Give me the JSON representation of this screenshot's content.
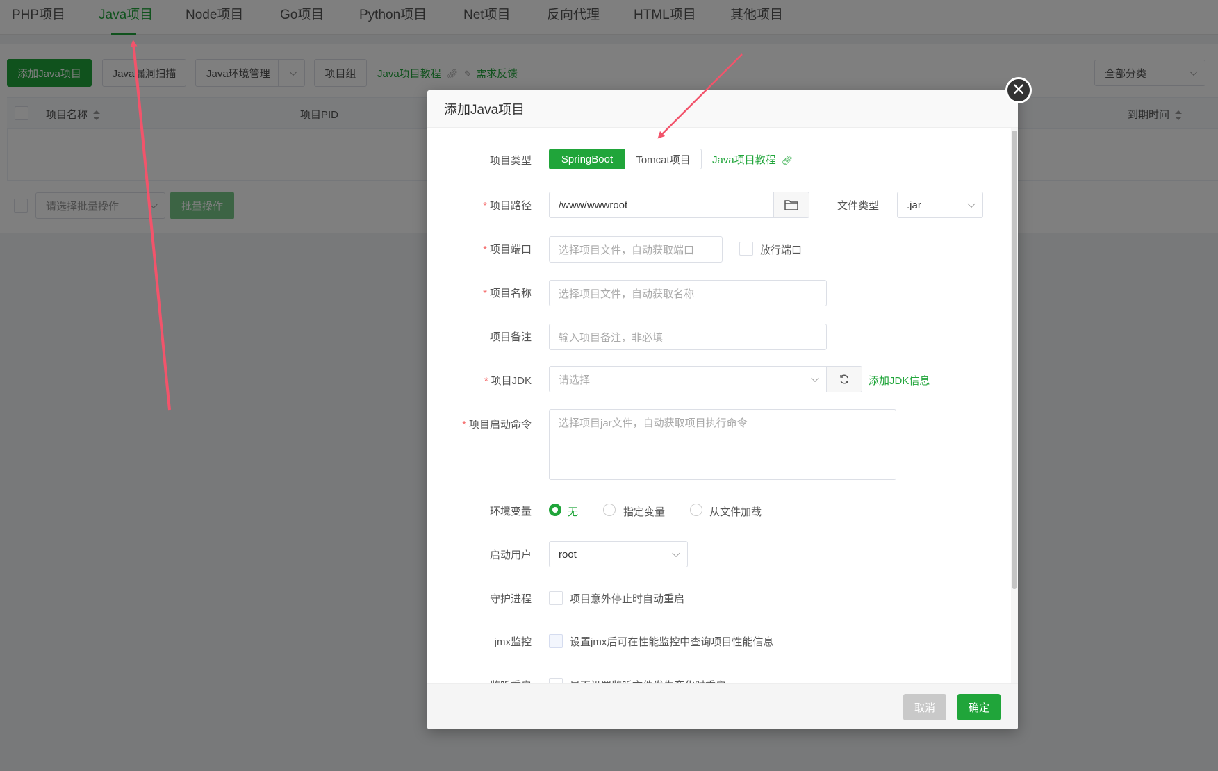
{
  "top_tabs": [
    {
      "label": "PHP项目",
      "active": false
    },
    {
      "label": "Java项目",
      "active": true
    },
    {
      "label": "Node项目",
      "active": false
    },
    {
      "label": "Go项目",
      "active": false
    },
    {
      "label": "Python项目",
      "active": false
    },
    {
      "label": "Net项目",
      "active": false
    },
    {
      "label": "反向代理",
      "active": false
    },
    {
      "label": "HTML项目",
      "active": false
    },
    {
      "label": "其他项目",
      "active": false
    }
  ],
  "toolbar": {
    "add_java_label": "添加Java项目",
    "scan_label": "Java漏洞扫描",
    "env_manage_label": "Java环境管理",
    "group_label": "项目组",
    "tutorial_label": "Java项目教程",
    "feedback_label": "需求反馈",
    "category_select": "全部分类"
  },
  "table": {
    "headers": {
      "name": "项目名称",
      "pid": "项目PID",
      "expire": "到期时间"
    },
    "batch_placeholder": "请选择批量操作",
    "batch_button": "批量操作"
  },
  "modal": {
    "title": "添加Java项目",
    "project_type": {
      "label": "项目类型",
      "options": [
        "SpringBoot",
        "Tomcat项目"
      ],
      "selected": "SpringBoot",
      "tutorial_link": "Java项目教程"
    },
    "project_path": {
      "label": "项目路径",
      "value": "/www/wwwroot"
    },
    "file_type": {
      "label": "文件类型",
      "value": ".jar"
    },
    "project_port": {
      "label": "项目端口",
      "placeholder": "选择项目文件，自动获取端口",
      "open_port_label": "放行端口"
    },
    "project_name": {
      "label": "项目名称",
      "placeholder": "选择项目文件，自动获取名称"
    },
    "project_note": {
      "label": "项目备注",
      "placeholder": "输入项目备注，非必填"
    },
    "project_jdk": {
      "label": "项目JDK",
      "placeholder": "请选择",
      "add_link": "添加JDK信息"
    },
    "start_command": {
      "label": "项目启动命令",
      "placeholder": "选择项目jar文件，自动获取项目执行命令"
    },
    "env_vars": {
      "label": "环境变量",
      "options": [
        "无",
        "指定变量",
        "从文件加载"
      ],
      "selected": "无"
    },
    "start_user": {
      "label": "启动用户",
      "value": "root"
    },
    "daemon": {
      "label": "守护进程",
      "text": "项目意外停止时自动重启"
    },
    "jmx": {
      "label": "jmx监控",
      "text": "设置jmx后可在性能监控中查询项目性能信息"
    },
    "watch_restart": {
      "label": "监听重启",
      "text": "是否设置监听文件发生变化时重启"
    },
    "cancel_label": "取消",
    "confirm_label": "确定"
  },
  "colors": {
    "accent": "#20a53a",
    "required": "#f56c6c",
    "annotation_arrow": "#f2546b"
  }
}
